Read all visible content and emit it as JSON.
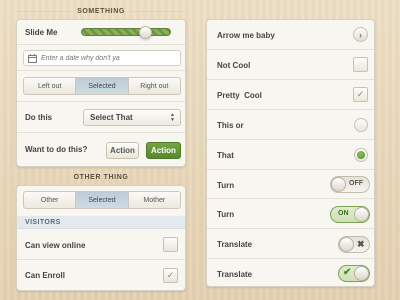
{
  "left": {
    "section1_title": "SOMETHING",
    "slider": {
      "label": "Slide Me",
      "value_fraction": 0.72
    },
    "date_input": {
      "placeholder": "Enter a date why don't ya",
      "icon": "calendar-icon"
    },
    "segmented1": {
      "options": [
        "Left out",
        "Selected",
        "Right out"
      ],
      "selected_index": 1
    },
    "do_this": {
      "label": "Do this",
      "select_value": "Select That"
    },
    "want": {
      "label": "Want to do this?",
      "button1": "Action",
      "button2": "Action"
    },
    "section2_title": "OTHER THING",
    "segmented2": {
      "options": [
        "Other",
        "Selected",
        "Mother"
      ],
      "selected_index": 1
    },
    "visitors_header": "VISITORS",
    "can_view": {
      "label": "Can view online",
      "checked": false
    },
    "can_enroll": {
      "label": "Can Enroll",
      "checked": true
    }
  },
  "right": {
    "rows": [
      {
        "label": "Arrow me baby",
        "control": "chevron-right-icon"
      },
      {
        "label": "Not Cool",
        "control": "checkbox",
        "checked": false
      },
      {
        "label": "Pretty  Cool",
        "control": "checkbox",
        "checked": true
      },
      {
        "label": "This or",
        "control": "radio",
        "selected": false
      },
      {
        "label": "That",
        "control": "radio",
        "selected": true
      },
      {
        "label": "Turn",
        "control": "toggle",
        "toggle_text": "OFF",
        "on": false
      },
      {
        "label": "Turn",
        "control": "toggle",
        "toggle_text": "ON",
        "on": true
      },
      {
        "label": "Translate",
        "control": "toggle",
        "symbol": "✖",
        "on": false
      },
      {
        "label": "Translate",
        "control": "toggle",
        "symbol": "✔",
        "on": true
      }
    ]
  },
  "colors": {
    "accent_green": "#578a2b",
    "selected_segment": "#c6d3dd",
    "background": "#ead9bd"
  }
}
